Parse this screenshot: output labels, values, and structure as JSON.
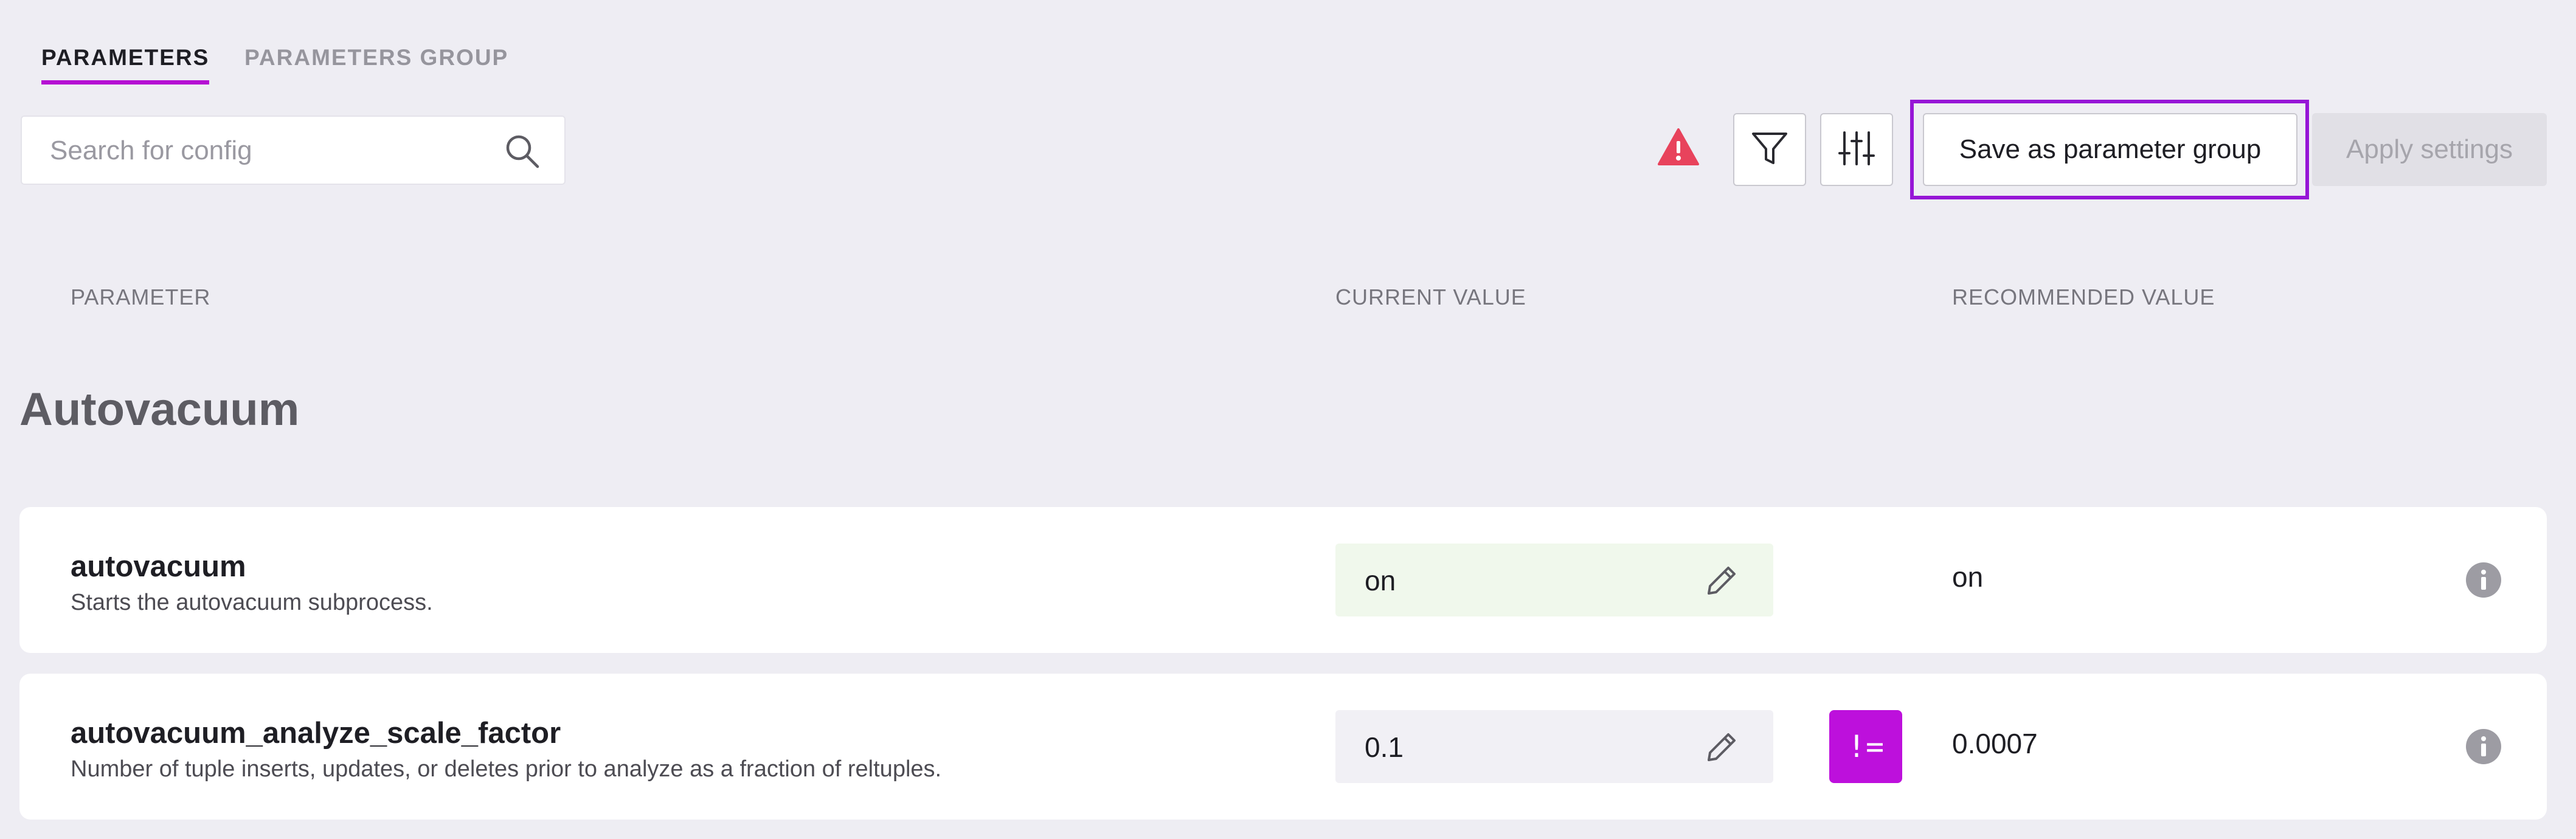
{
  "tabs": [
    {
      "label": "PARAMETERS",
      "active": true
    },
    {
      "label": "PARAMETERS GROUP",
      "active": false
    }
  ],
  "search": {
    "placeholder": "Search for config",
    "value": "",
    "icon": "search-icon"
  },
  "toolbar": {
    "warning_icon": "warning-triangle-icon",
    "filter_icon": "filter-icon",
    "adjust_icon": "sliders-icon",
    "save_label": "Save as parameter group",
    "apply_label": "Apply settings"
  },
  "columns": {
    "parameter": "PARAMETER",
    "current_value": "CURRENT VALUE",
    "recommended_value": "RECOMMENDED VALUE"
  },
  "section": {
    "title": "Autovacuum"
  },
  "parameters": [
    {
      "name": "autovacuum",
      "description": "Starts the autovacuum subprocess.",
      "current_value": "on",
      "recommended_value": "on",
      "differs": false
    },
    {
      "name": "autovacuum_analyze_scale_factor",
      "description": "Number of tuple inserts, updates, or deletes prior to analyze as a fraction of reltuples.",
      "current_value": "0.1",
      "recommended_value": "0.0007",
      "differs": true,
      "diff_badge": "!="
    }
  ],
  "colors": {
    "accent": "#b510d3",
    "highlight_border": "#9616d6",
    "warning": "#e8435c",
    "matching_value_bg": "#f0f8ec",
    "background": "#eeedf3"
  }
}
